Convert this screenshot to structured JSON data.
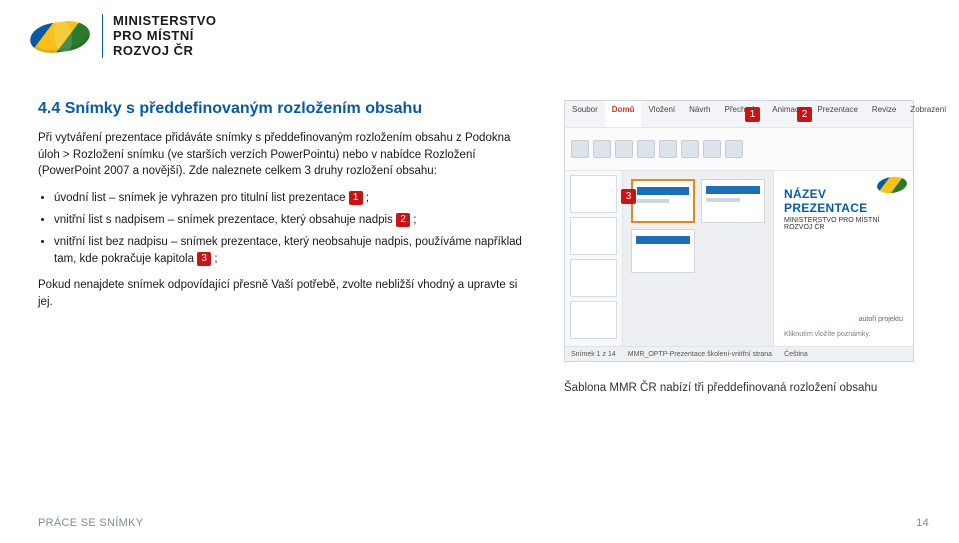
{
  "org": {
    "line1": "MINISTERSTVO",
    "line2": "PRO MÍSTNÍ",
    "line3": "ROZVOJ ČR"
  },
  "heading": "4.4 Snímky s předdefinovaným rozložením obsahu",
  "para1": "Při vytváření prezentace přidáváte snímky s předdefinovaným rozložením obsahu z Podokna úloh > Rozložení snímku (ve starších verzích PowerPointu) nebo v nabídce Rozložení (PowerPoint 2007 a novější). Zde naleznete celkem 3 druhy rozložení obsahu:",
  "bullets": [
    {
      "pre": "úvodní list – snímek je vyhrazen pro titulní list prezentace ",
      "num": "1",
      "post": " ;"
    },
    {
      "pre": "vnitřní list s nadpisem – snímek prezentace, který obsahuje nadpis ",
      "num": "2",
      "post": " ;"
    },
    {
      "pre": "vnitřní list bez nadpisu – snímek prezentace, který neobsahuje nadpis, používáme například tam, kde pokračuje kapitola ",
      "num": "3",
      "post": " ;"
    }
  ],
  "closing": "Pokud nenajdete snímek odpovídající přesně Vaší potřebě, zvolte nebližší vhodný a upravte si jej.",
  "callouts": {
    "n1": "1",
    "n2": "2",
    "n3": "3"
  },
  "screenshot": {
    "tabs": [
      "Soubor",
      "Domů",
      "Vložení",
      "Návrh",
      "Přechody",
      "Animace",
      "Prezentace",
      "Revize",
      "Zobrazení"
    ],
    "tab_active_index": 1,
    "preview_title": "NÁZEV PREZENTACE",
    "preview_subtitle": "MINISTERSTVO PRO MÍSTNÍ ROZVOJ ČR",
    "preview_author": "autoři projektu",
    "preview_hint": "Kliknutím vložíte poznámky.",
    "status_left": "Snímek 1 z 14",
    "status_mid": "MMR_OPTP-Prezentace školení-vnitřní strana",
    "status_lang": "Čeština"
  },
  "caption": "Šablona MMR ČR nabízí tři předdefinovaná rozložení obsahu",
  "footer": {
    "section": "PRÁCE SE SNÍMKY",
    "page": "14"
  }
}
